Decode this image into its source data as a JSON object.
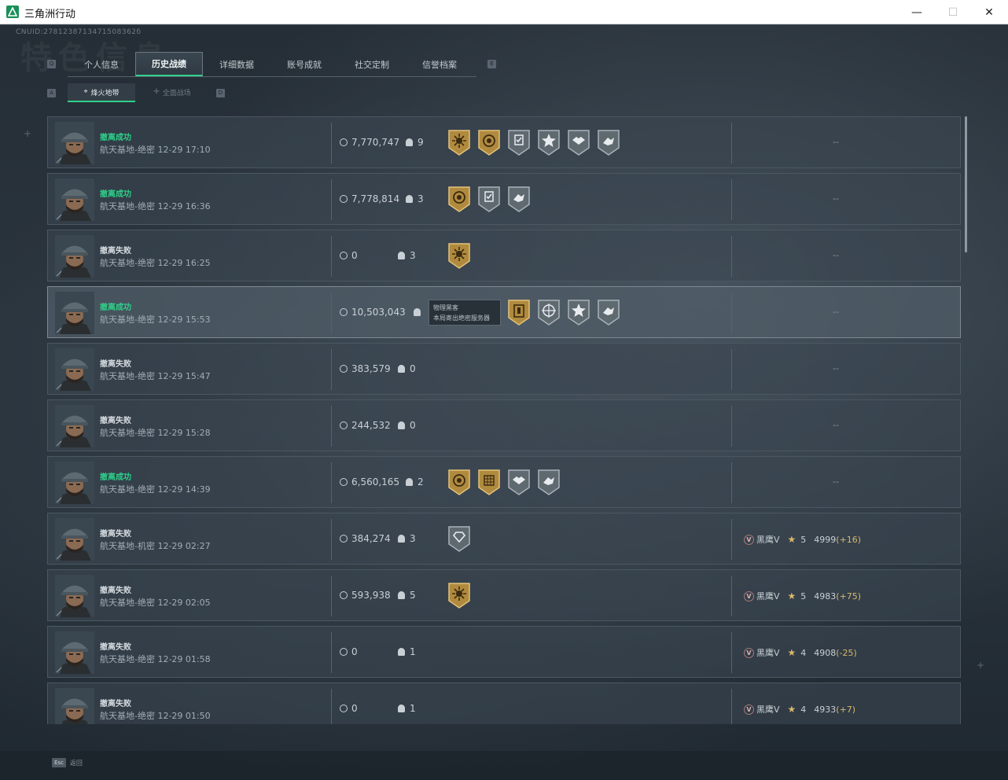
{
  "window": {
    "title": "三角洲行动",
    "minimize_glyph": "—",
    "maximize_glyph": "☐",
    "close_glyph": "✕"
  },
  "header": {
    "cnuid": "CNUID:2781238713471508362б",
    "bg_title": "特色信息"
  },
  "keys": {
    "left": "Q",
    "right": "E",
    "sub_left": "A",
    "sub_right": "D"
  },
  "tabs": [
    {
      "label": "个人信息",
      "active": false
    },
    {
      "label": "历史战绩",
      "active": true
    },
    {
      "label": "详细数据",
      "active": false
    },
    {
      "label": "账号成就",
      "active": false
    },
    {
      "label": "社交定制",
      "active": false
    },
    {
      "label": "信誉档案",
      "active": false
    }
  ],
  "subtabs": [
    {
      "label": "烽火地带",
      "active": true,
      "icon": "crosshair-icon"
    },
    {
      "label": "全面战场",
      "active": false,
      "icon": "target-icon"
    }
  ],
  "tooltip": {
    "line1": "物理黑客",
    "line2": "本局寄出绝密服务器"
  },
  "rows": [
    {
      "status": "撤离成功",
      "success": true,
      "map": "航天基地-绝密 12-29 17:10",
      "money": "7,770,747",
      "kills": "9",
      "badges": [
        "gold-sun",
        "gold-circle",
        "silver-check",
        "silver-star",
        "silver-shake",
        "silver-hands"
      ],
      "rank": null,
      "dash": "--"
    },
    {
      "status": "撤离成功",
      "success": true,
      "map": "航天基地-绝密 12-29 16:36",
      "money": "7,778,814",
      "kills": "3",
      "badges": [
        "gold-circle",
        "silver-check",
        "silver-hands"
      ],
      "rank": null,
      "dash": "--"
    },
    {
      "status": "撤离失败",
      "success": false,
      "map": "航天基地-绝密 12-29 16:25",
      "money": "0",
      "kills": "3",
      "badges": [
        "gold-sun"
      ],
      "rank": null,
      "dash": "--"
    },
    {
      "status": "撤离成功",
      "success": true,
      "map": "航天基地-绝密 12-29 15:53",
      "money": "10,503,043",
      "kills": "",
      "badges": [
        "gold-door",
        "silver-scope",
        "silver-star",
        "silver-hands"
      ],
      "rank": null,
      "dash": "--",
      "tooltip": true
    },
    {
      "status": "撤离失败",
      "success": false,
      "map": "航天基地-绝密 12-29 15:47",
      "money": "383,579",
      "kills": "0",
      "badges": [],
      "rank": null,
      "dash": "--"
    },
    {
      "status": "撤离失败",
      "success": false,
      "map": "航天基地-绝密 12-29 15:28",
      "money": "244,532",
      "kills": "0",
      "badges": [],
      "rank": null,
      "dash": "--"
    },
    {
      "status": "撤离成功",
      "success": true,
      "map": "航天基地-绝密 12-29 14:39",
      "money": "6,560,165",
      "kills": "2",
      "badges": [
        "gold-circle",
        "gold-grid",
        "silver-shake",
        "silver-hands"
      ],
      "rank": null,
      "dash": "--"
    },
    {
      "status": "撤离失败",
      "success": false,
      "map": "航天基地-机密 12-29 02:27",
      "money": "384,274",
      "kills": "3",
      "badges": [
        "silver-gem"
      ],
      "rank": {
        "name": "黑鹰V",
        "stars": "5",
        "score": "4999",
        "delta": "(+16)"
      },
      "dash": ""
    },
    {
      "status": "撤离失败",
      "success": false,
      "map": "航天基地-绝密 12-29 02:05",
      "money": "593,938",
      "kills": "5",
      "badges": [
        "gold-sun"
      ],
      "rank": {
        "name": "黑鹰V",
        "stars": "5",
        "score": "4983",
        "delta": "(+75)"
      },
      "dash": ""
    },
    {
      "status": "撤离失败",
      "success": false,
      "map": "航天基地-绝密 12-29 01:58",
      "money": "0",
      "kills": "1",
      "badges": [],
      "rank": {
        "name": "黑鹰V",
        "stars": "4",
        "score": "4908",
        "delta": "(-25)"
      },
      "dash": ""
    },
    {
      "status": "撤离失败",
      "success": false,
      "map": "航天基地-绝密 12-29 01:50",
      "money": "0",
      "kills": "1",
      "badges": [],
      "rank": {
        "name": "黑鹰V",
        "stars": "4",
        "score": "4933",
        "delta": "(+7)"
      },
      "dash": ""
    }
  ],
  "footer": {
    "key": "Esc",
    "label": "返回"
  },
  "colors": {
    "success": "#2fd08a",
    "gold": "#c9a24a",
    "silver": "#8d979f"
  }
}
